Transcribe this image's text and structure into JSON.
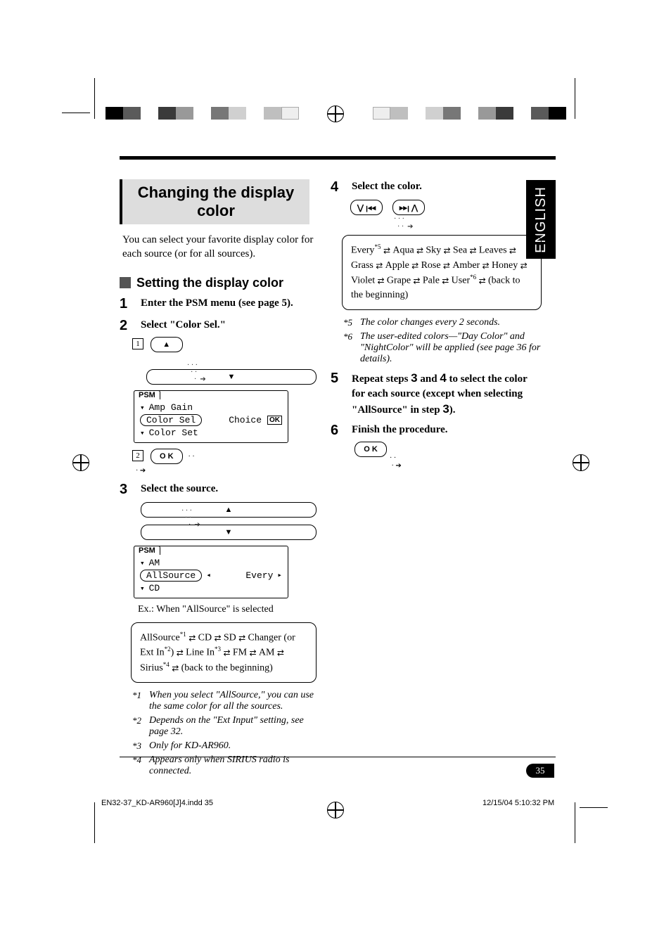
{
  "language_tab": "ENGLISH",
  "title": "Changing the display color",
  "intro": "You can select your favorite display color for each source (or for all sources).",
  "subheading": "Setting the display color",
  "steps": {
    "s1": {
      "num": "1",
      "text": "Enter the PSM menu (see page 5)."
    },
    "s2": {
      "num": "2",
      "text": "Select \"Color Sel.\""
    },
    "s3": {
      "num": "3",
      "text": "Select the source."
    },
    "s4": {
      "num": "4",
      "text": "Select the color."
    },
    "s5": {
      "num": "5",
      "text_a": "Repeat steps ",
      "b1": "3",
      "text_b": " and ",
      "b2": "4",
      "text_c": " to select the color for each source (except when selecting \"AllSource\" in step ",
      "b3": "3",
      "text_d": ")."
    },
    "s6": {
      "num": "6",
      "text": "Finish the procedure."
    }
  },
  "buttons": {
    "up": "▲",
    "down": "▼",
    "ok": "O K",
    "prev": "⋁ ꞁ◂◂",
    "next": "▸▸ꞁ ⋀"
  },
  "lcd1": {
    "psm": "PSM",
    "r1": "Amp Gain",
    "r2": "Color Sel",
    "r3": "Color Set",
    "choice": "Choice",
    "ok": "OK"
  },
  "lcd2": {
    "psm": "PSM",
    "r1": "AM",
    "r2": "AllSource",
    "r3": "CD",
    "val": "Every"
  },
  "caption2": "Ex.: When \"AllSource\" is selected",
  "sources_box": {
    "items": [
      "AllSource",
      "CD",
      "SD",
      "Changer (or Ext In",
      "Line In",
      "FM",
      "AM",
      "Sirius",
      "(back to the beginning)"
    ],
    "sup_allsource": "*1",
    "sup_extin": "*2",
    "sup_linein": "*3",
    "sup_sirius": "*4",
    "text": "AllSource*1 ⇄ CD ⇄ SD ⇄ Changer (or Ext In*2) ⇄ Line In*3 ⇄ FM ⇄ AM ⇄ Sirius*4 ⇄ (back to the beginning)"
  },
  "footnotes_left": {
    "f1": {
      "tag": "*1",
      "txt": "When you select \"AllSource,\" you can use the same color for all the sources."
    },
    "f2": {
      "tag": "*2",
      "txt": "Depends on the \"Ext Input\" setting, see page 32."
    },
    "f3": {
      "tag": "*3",
      "txt": "Only for KD-AR960."
    },
    "f4": {
      "tag": "*4",
      "txt": "Appears only when SIRIUS radio is connected."
    }
  },
  "colors_box": {
    "text": "Every*5 ⇄ Aqua ⇄ Sky ⇄ Sea ⇄ Leaves ⇄ Grass ⇄ Apple ⇄ Rose ⇄ Amber ⇄ Honey ⇄ Violet ⇄ Grape ⇄ Pale ⇄ User*6 ⇄ (back to the beginning)",
    "sup_every": "*5",
    "sup_user": "*6",
    "items": [
      "Every",
      "Aqua",
      "Sky",
      "Sea",
      "Leaves",
      "Grass",
      "Apple",
      "Rose",
      "Amber",
      "Honey",
      "Violet",
      "Grape",
      "Pale",
      "User",
      "(back to the beginning)"
    ]
  },
  "footnotes_right": {
    "f5": {
      "tag": "*5",
      "txt": "The color changes every 2 seconds."
    },
    "f6": {
      "tag": "*6",
      "txt": "The user-edited colors—\"Day Color\" and \"NightColor\" will be applied (see page 36 for details)."
    }
  },
  "page_number": "35",
  "footer_left": "EN32-37_KD-AR960[J]4.indd   35",
  "footer_right": "12/15/04   5:10:32 PM",
  "box_numbers": {
    "a": "1",
    "b": "2"
  },
  "colorbar": [
    "#000000",
    "#5a5a5a",
    "#3a3a3a",
    "#999999",
    "#777777",
    "#d0d0d0",
    "#bfbfbf"
  ]
}
